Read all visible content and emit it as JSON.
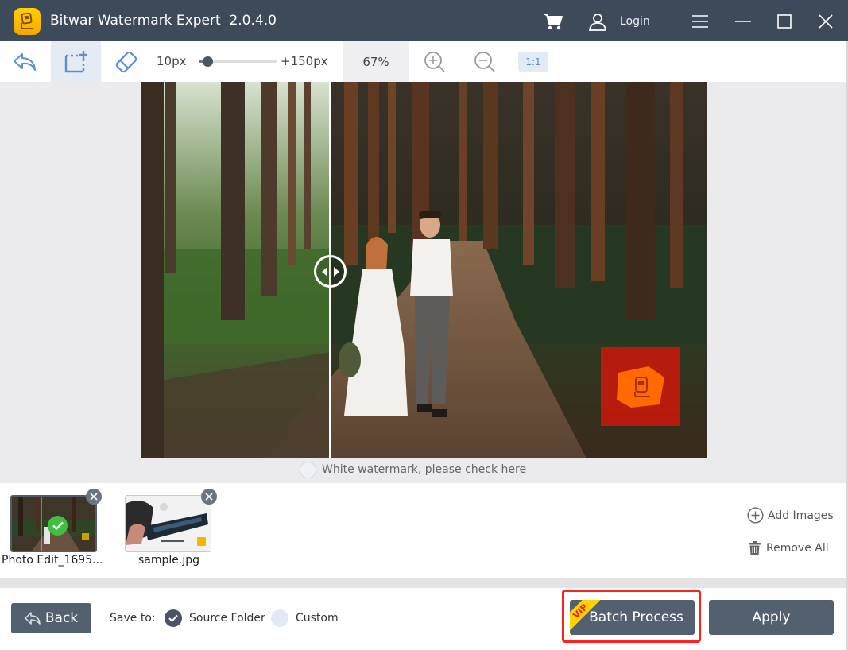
{
  "titlebar": {
    "app_name": "Bitwar Watermark Expert  2.0.4.0",
    "login_label": "Login",
    "icons": [
      "app-logo-icon",
      "cart-icon",
      "user-icon",
      "menu-icon",
      "minimize-icon",
      "maximize-icon",
      "close-icon"
    ]
  },
  "toolbar": {
    "tools": [
      "undo",
      "rect-select",
      "eraser"
    ],
    "active_tool": "rect-select",
    "brush_min_label": "10px",
    "brush_max_label": "+150px",
    "brush_size_fraction": 0.07,
    "zoom_label": "67%",
    "actual_size_label": "1:1"
  },
  "canvas": {
    "compare_split_fraction": 0.33,
    "white_watermark_label": "White watermark, please check here",
    "white_watermark_checked": false,
    "watermark_color": "#c8180a",
    "watermark_logo_color": "#ff6a00"
  },
  "thumbnails": [
    {
      "name": "Photo Edit_1695...",
      "processed": true,
      "selected": true
    },
    {
      "name": "sample.jpg",
      "processed": false,
      "selected": false
    }
  ],
  "strip_actions": {
    "add_images": "Add Images",
    "remove_all": "Remove All"
  },
  "bottom": {
    "back_label": "Back",
    "save_to_label": "Save to:",
    "options": [
      {
        "label": "Source Folder",
        "checked": true
      },
      {
        "label": "Custom",
        "checked": false
      }
    ],
    "batch_label": "Batch Process",
    "vip_badge": "VIP",
    "apply_label": "Apply",
    "highlight_color": "#ff2020"
  },
  "colors": {
    "titlebar_bg": "#3d4a5a",
    "button_bg": "#536070",
    "accent_blue": "#5c8fd0",
    "canvas_bg": "#ebebee"
  }
}
